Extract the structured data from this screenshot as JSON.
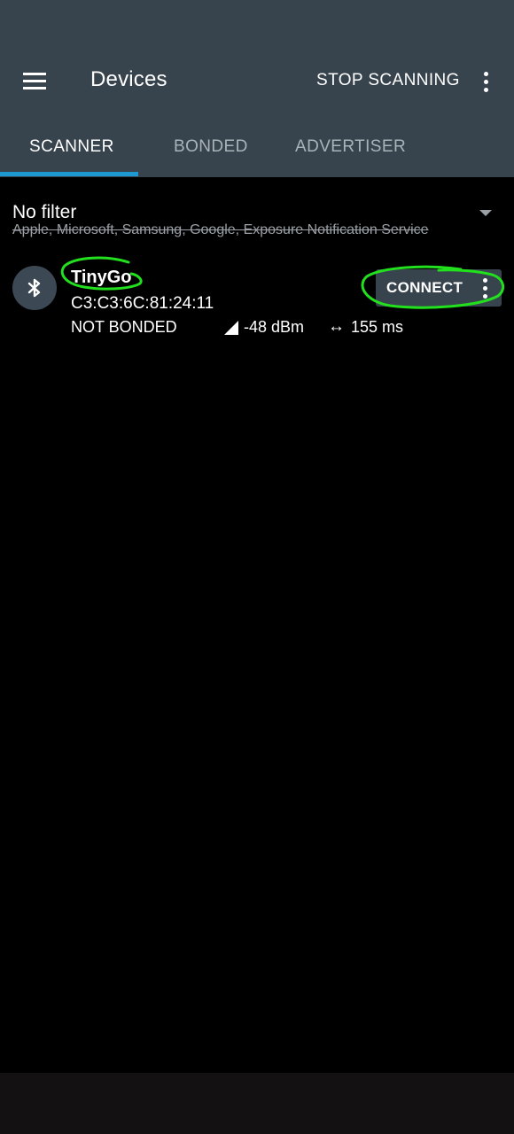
{
  "appbar": {
    "title": "Devices",
    "stop_scanning_label": "STOP SCANNING",
    "background": "#37434d"
  },
  "tabs": [
    {
      "label": "SCANNER",
      "active": true
    },
    {
      "label": "BONDED",
      "active": false
    },
    {
      "label": "ADVERTISER",
      "active": false
    }
  ],
  "accent": "#1e98d1",
  "filter": {
    "title": "No filter",
    "subtitle": "Apple, Microsoft, Samsung, Google, Exposure Notification Service"
  },
  "devices": [
    {
      "icon": "bluetooth-icon",
      "name": "TinyGo",
      "address": "C3:C3:6C:81:24:11",
      "bond_state": "NOT BONDED",
      "rssi": "-48 dBm",
      "interval": "155 ms",
      "connect_label": "CONNECT"
    }
  ],
  "annotation_color": "#22e01d"
}
